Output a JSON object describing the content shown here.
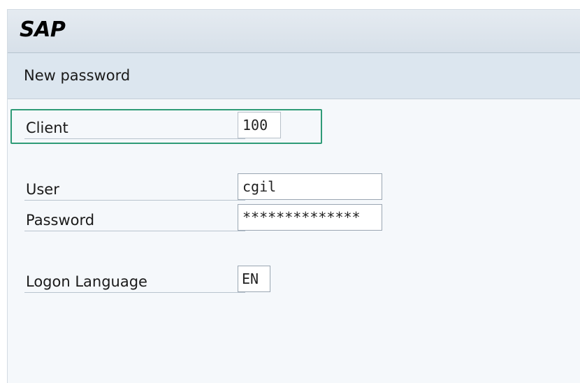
{
  "app": {
    "logo_text": "SAP"
  },
  "screen": {
    "title": "New password"
  },
  "form": {
    "client": {
      "label": "Client",
      "value": "100"
    },
    "user": {
      "label": "User",
      "value": "cgil"
    },
    "password": {
      "label": "Password",
      "value": "**************"
    },
    "language": {
      "label": "Logon Language",
      "value": "EN"
    }
  },
  "colors": {
    "highlight": "#2f9b77"
  }
}
